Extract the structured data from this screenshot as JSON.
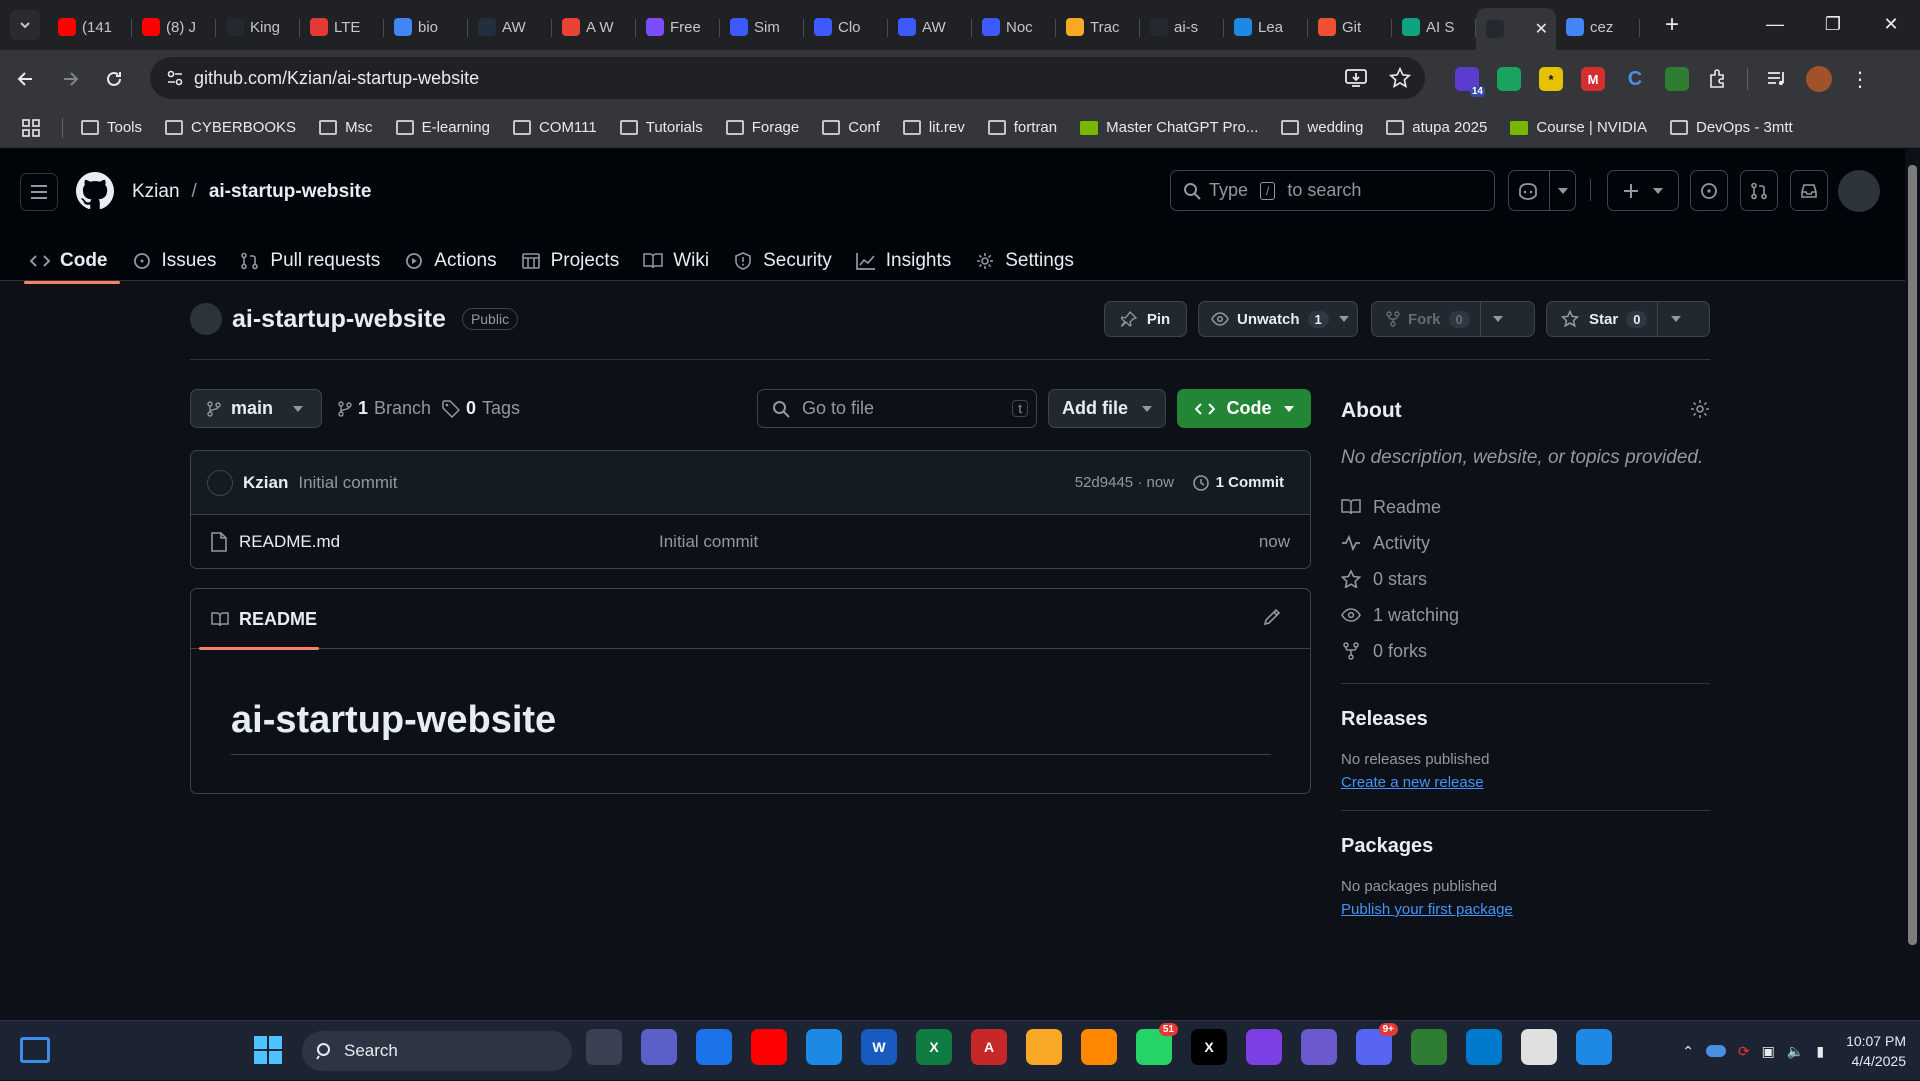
{
  "browser": {
    "tabs": [
      {
        "label": "(141",
        "favicon": "youtube-icon",
        "color": "#ff0000"
      },
      {
        "label": "(8) J",
        "favicon": "youtube-icon",
        "color": "#ff0000"
      },
      {
        "label": "King",
        "favicon": "github-icon",
        "color": "#24292f"
      },
      {
        "label": "LTE",
        "favicon": "lte-icon",
        "color": "#e53935"
      },
      {
        "label": "bio",
        "favicon": "google-icon",
        "color": "#4285f4"
      },
      {
        "label": "AW",
        "favicon": "aws-icon",
        "color": "#232f3e"
      },
      {
        "label": "A W",
        "favicon": "gmail-icon",
        "color": "#ea4335"
      },
      {
        "label": "Free",
        "favicon": "cube-icon",
        "color": "#7c4dff"
      },
      {
        "label": "Sim",
        "favicon": "shield-icon",
        "color": "#3d5afe"
      },
      {
        "label": "Clo",
        "favicon": "shield-icon",
        "color": "#3d5afe"
      },
      {
        "label": "AW",
        "favicon": "shield-icon",
        "color": "#3d5afe"
      },
      {
        "label": "Noc",
        "favicon": "shield-icon",
        "color": "#3d5afe"
      },
      {
        "label": "Trac",
        "favicon": "box-icon",
        "color": "#f9a825"
      },
      {
        "label": "ai-s",
        "favicon": "github-icon",
        "color": "#24292f"
      },
      {
        "label": "Lea",
        "favicon": "learn-icon",
        "color": "#1e88e5"
      },
      {
        "label": "Git",
        "favicon": "git-icon",
        "color": "#f05032"
      },
      {
        "label": "AI S",
        "favicon": "openai-icon",
        "color": "#10a37f"
      },
      {
        "label": "",
        "favicon": "github-icon",
        "color": "#24292f",
        "active": true
      },
      {
        "label": "cez",
        "favicon": "google-icon",
        "color": "#4285f4"
      }
    ],
    "url": "github.com/Kzian/ai-startup-website",
    "extension_badge": "14",
    "bookmarks": [
      {
        "label": "Tools",
        "type": "folder"
      },
      {
        "label": "CYBERBOOKS",
        "type": "folder"
      },
      {
        "label": "Msc",
        "type": "folder"
      },
      {
        "label": "E-learning",
        "type": "folder"
      },
      {
        "label": "COM111",
        "type": "folder"
      },
      {
        "label": "Tutorials",
        "type": "folder"
      },
      {
        "label": "Forage",
        "type": "folder"
      },
      {
        "label": "Conf",
        "type": "folder"
      },
      {
        "label": "lit.rev",
        "type": "folder"
      },
      {
        "label": "fortran",
        "type": "folder"
      },
      {
        "label": "Master ChatGPT Pro...",
        "type": "link"
      },
      {
        "label": "wedding",
        "type": "folder"
      },
      {
        "label": "atupa 2025",
        "type": "folder"
      },
      {
        "label": "Course | NVIDIA",
        "type": "link"
      },
      {
        "label": "DevOps - 3mtt",
        "type": "folder"
      }
    ]
  },
  "github": {
    "breadcrumb": {
      "owner": "Kzian",
      "separator": "/",
      "repo": "ai-startup-website"
    },
    "search": {
      "prefix": "Type",
      "key": "/",
      "suffix": "to search"
    },
    "repo_nav": [
      {
        "label": "Code",
        "icon": "code-icon",
        "selected": true
      },
      {
        "label": "Issues",
        "icon": "issue-icon"
      },
      {
        "label": "Pull requests",
        "icon": "pull-request-icon"
      },
      {
        "label": "Actions",
        "icon": "play-icon"
      },
      {
        "label": "Projects",
        "icon": "table-icon"
      },
      {
        "label": "Wiki",
        "icon": "book-icon"
      },
      {
        "label": "Security",
        "icon": "shield-icon"
      },
      {
        "label": "Insights",
        "icon": "graph-icon"
      },
      {
        "label": "Settings",
        "icon": "gear-icon"
      }
    ],
    "repo": {
      "name": "ai-startup-website",
      "visibility": "Public",
      "actions": {
        "pin": "Pin",
        "unwatch": "Unwatch",
        "unwatch_count": "1",
        "fork": "Fork",
        "fork_count": "0",
        "star": "Star",
        "star_count": "0"
      },
      "branch": "main",
      "branches_count": "1",
      "branches_label": "Branch",
      "tags_count": "0",
      "tags_label": "Tags",
      "go_to_file": "Go to file",
      "go_to_file_key": "t",
      "add_file": "Add file",
      "code_button": "Code",
      "latest_commit": {
        "author": "Kzian",
        "message": "Initial commit",
        "sha": "52d9445 · now",
        "count": "1 Commit"
      },
      "files": [
        {
          "name": "README.md",
          "commit": "Initial commit",
          "age": "now"
        }
      ],
      "readme": {
        "tab": "README",
        "heading": "ai-startup-website"
      }
    },
    "about": {
      "title": "About",
      "description": "No description, website, or topics provided.",
      "items": [
        {
          "label": "Readme",
          "icon": "book-icon"
        },
        {
          "label": "Activity",
          "icon": "pulse-icon"
        },
        {
          "label": "0 stars",
          "icon": "star-icon"
        },
        {
          "label": "1 watching",
          "icon": "eye-icon"
        },
        {
          "label": "0 forks",
          "icon": "fork-icon"
        }
      ],
      "releases": {
        "title": "Releases",
        "none": "No releases published",
        "link": "Create a new release"
      },
      "packages": {
        "title": "Packages",
        "none": "No packages published",
        "link": "Publish your first package"
      }
    }
  },
  "taskbar": {
    "search": "Search",
    "apps": [
      {
        "name": "task-view-icon",
        "color": "#3a4152",
        "text": ""
      },
      {
        "name": "teams-icon",
        "color": "#5b5fc7",
        "text": ""
      },
      {
        "name": "chrome-icon",
        "color": "#1a73e8",
        "text": ""
      },
      {
        "name": "youtube-music-icon",
        "color": "#ff0000",
        "text": ""
      },
      {
        "name": "notepad-icon",
        "color": "#1e88e5",
        "text": ""
      },
      {
        "name": "word-icon",
        "color": "#185abd",
        "text": "W"
      },
      {
        "name": "excel-icon",
        "color": "#107c41",
        "text": "X"
      },
      {
        "name": "acrobat-icon",
        "color": "#c62828",
        "text": "A"
      },
      {
        "name": "file-explorer-icon",
        "color": "#f9a825",
        "text": ""
      },
      {
        "name": "vlc-icon",
        "color": "#ff8800",
        "text": ""
      },
      {
        "name": "whatsapp-icon",
        "color": "#25d366",
        "text": "",
        "badge": "51"
      },
      {
        "name": "x-icon",
        "color": "#000000",
        "text": "X"
      },
      {
        "name": "copilot-icon",
        "color": "#7b3fe4",
        "text": ""
      },
      {
        "name": "notion-ai-icon",
        "color": "#6a5acd",
        "text": ""
      },
      {
        "name": "discord-icon",
        "color": "#5865f2",
        "text": "",
        "badge": "9+"
      },
      {
        "name": "snip-icon",
        "color": "#2e7d32",
        "text": ""
      },
      {
        "name": "vscode-icon",
        "color": "#007acc",
        "text": ""
      },
      {
        "name": "clock-app-icon",
        "color": "#e0e0e0",
        "text": ""
      },
      {
        "name": "paint-icon",
        "color": "#1e88e5",
        "text": ""
      }
    ],
    "time": "10:07 PM",
    "date": "4/4/2025"
  }
}
